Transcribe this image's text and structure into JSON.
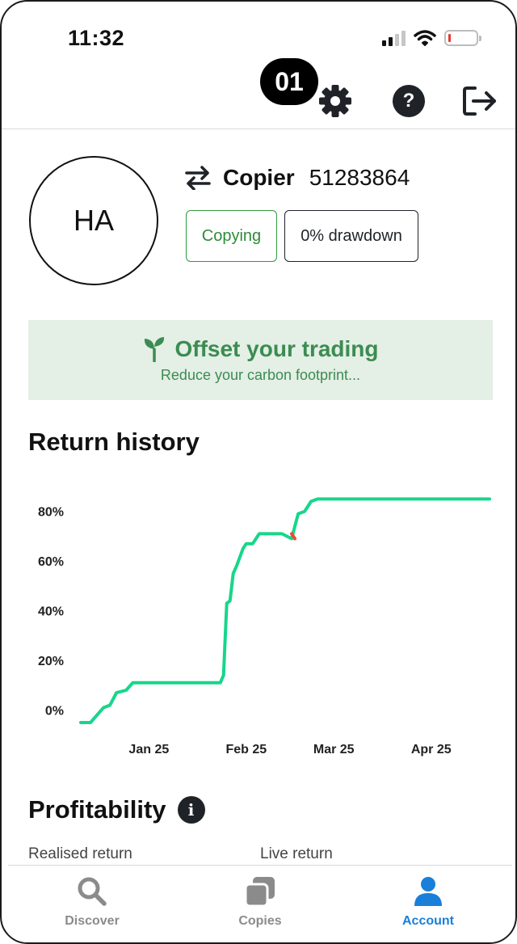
{
  "status_bar": {
    "time": "11:32",
    "icons": [
      "cellular-signal-icon",
      "wifi-icon",
      "battery-low-icon"
    ]
  },
  "header": {
    "step_badge": "01",
    "icons": [
      "gear-icon",
      "help-icon",
      "logout-icon"
    ],
    "help_glyph": "?"
  },
  "profile": {
    "avatar_initials": "HA",
    "type_label": "Copier",
    "account_id": "51283864",
    "tags": {
      "copying": "Copying",
      "drawdown": "0% drawdown"
    }
  },
  "offset_banner": {
    "title": "Offset your trading",
    "subtitle": "Reduce your carbon footprint..."
  },
  "return_history": {
    "title": "Return history"
  },
  "chart_data": {
    "type": "line",
    "title": "Return history",
    "xlabel": "",
    "ylabel": "",
    "x_tick_labels": [
      "Jan 25",
      "Feb 25",
      "Mar 25",
      "Apr 25"
    ],
    "y_tick_labels": [
      "0%",
      "20%",
      "40%",
      "60%",
      "80%"
    ],
    "y_ticks": [
      0,
      20,
      40,
      60,
      80
    ],
    "ylim": [
      -5,
      90
    ],
    "grid": false,
    "legend": "none",
    "series": [
      {
        "color": "#17d68a",
        "x": [
          "2024-12-25",
          "2024-12-28",
          "2025-01-01",
          "2025-01-03",
          "2025-01-05",
          "2025-01-08",
          "2025-01-10",
          "2025-01-13",
          "2025-01-15",
          "2025-01-20",
          "2025-01-31",
          "2025-02-06",
          "2025-02-07",
          "2025-02-08",
          "2025-02-09",
          "2025-02-10",
          "2025-02-11",
          "2025-02-13",
          "2025-02-14",
          "2025-02-16",
          "2025-02-18",
          "2025-02-20",
          "2025-02-22",
          "2025-02-25",
          "2025-02-28",
          "2025-03-01",
          "2025-03-02",
          "2025-03-04",
          "2025-03-06",
          "2025-03-08",
          "2025-03-10",
          "2025-04-30"
        ],
        "y": [
          -5,
          -5,
          1,
          2,
          7,
          8,
          11,
          11,
          11,
          11,
          11,
          11,
          14,
          43,
          44,
          55,
          58,
          65,
          67,
          67,
          71,
          71,
          71,
          71,
          69,
          74,
          79,
          80,
          84,
          85,
          85,
          85
        ]
      },
      {
        "color": "#e74c3c",
        "x": [
          "2025-02-28",
          "2025-03-01"
        ],
        "y": [
          71,
          69
        ]
      }
    ]
  },
  "profitability": {
    "title": "Profitability",
    "info_glyph": "i",
    "realised_label": "Realised return",
    "live_label": "Live return"
  },
  "bottom_nav": {
    "items": [
      {
        "label": "Discover",
        "icon": "search-icon",
        "active": false
      },
      {
        "label": "Copies",
        "icon": "copies-icon",
        "active": false
      },
      {
        "label": "Account",
        "icon": "user-icon",
        "active": true
      }
    ],
    "active_color": "#1a7fd9",
    "inactive_color": "#8b8b8b"
  }
}
